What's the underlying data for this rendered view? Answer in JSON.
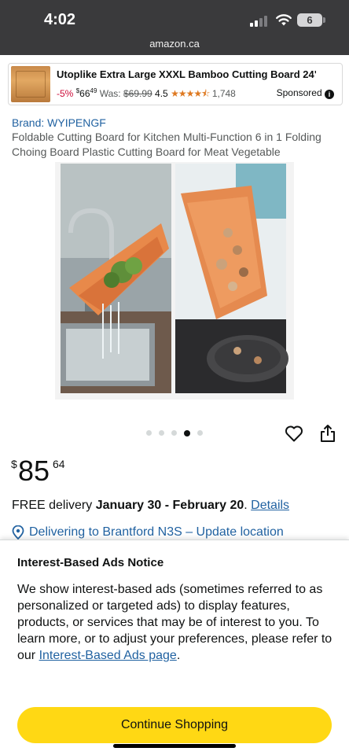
{
  "status_bar": {
    "time": "4:02",
    "battery": "6",
    "url": "amazon.ca"
  },
  "sponsored": {
    "title": "Utoplike Extra Large XXXL Bamboo Cutting Board 24\"...",
    "discount": "-5%",
    "price_currency": "$",
    "price_whole": "66",
    "price_fraction": "49",
    "was_label": "Was:",
    "was_price": "$69.99",
    "rating": "4.5",
    "stars": "★★★★⯪",
    "review_count": "1,748",
    "label": "Sponsored",
    "info_glyph": "i"
  },
  "product": {
    "brand": "Brand: WYIPENGF",
    "title": "Foldable Cutting Board for Kitchen Multi-Function 6 in 1 Folding Choing Board Plastic Cutting Board for Meat Vegetable",
    "image_count": 5,
    "active_image": 4,
    "price_currency": "$",
    "price_whole": "85",
    "price_fraction": "64"
  },
  "delivery": {
    "prefix": "FREE delivery ",
    "dates": "January 30 - February 20",
    "suffix": ". ",
    "link": "Details"
  },
  "location": {
    "text": "Delivering to Brantford N3S – Update location",
    "icon": "location-pin-icon"
  },
  "notice": {
    "title": "Interest-Based Ads Notice",
    "body_before_link": "We show interest-based ads (sometimes referred to as personalized or targeted ads) to display features, products, or services that may be of interest to you. To learn more, or to adjust your preferences, please refer to our ",
    "link": "Interest-Based Ads page",
    "body_after_link": ".",
    "button": "Continue Shopping"
  },
  "colors": {
    "link": "#2162a1",
    "discount": "#cc0c39",
    "star": "#de7921",
    "button": "#ffd814",
    "status_bar": "#3a3a3c"
  }
}
